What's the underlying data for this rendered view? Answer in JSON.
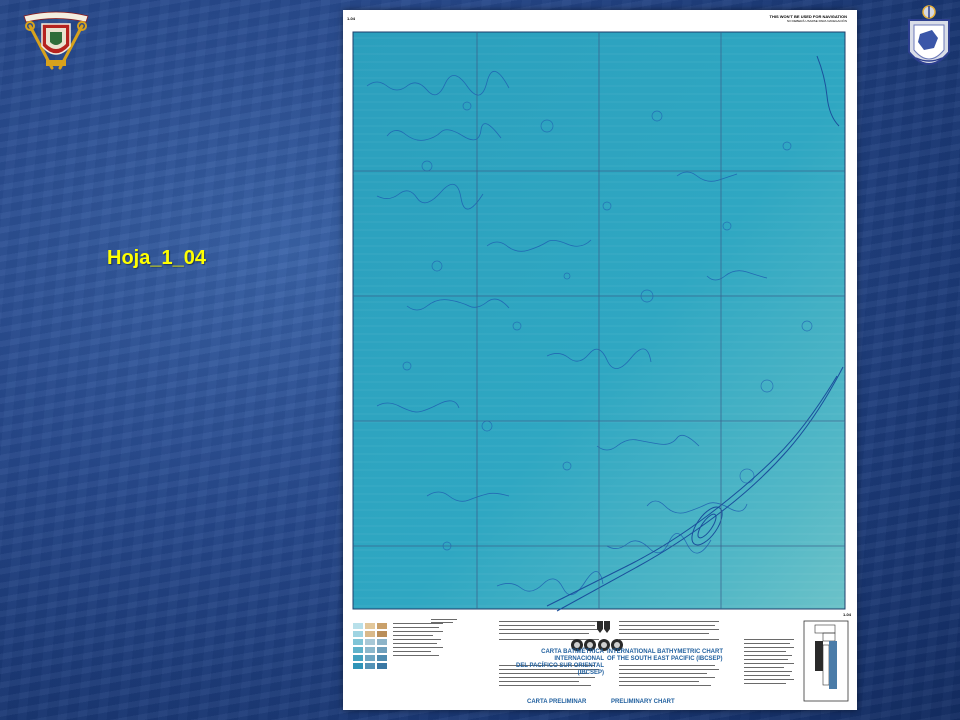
{
  "slide": {
    "title": "Hoja_1_04",
    "title_color": "#ffff00",
    "background_color": "#27498c"
  },
  "chart_sheet": {
    "sheet_id": "1-04",
    "warning": "THIS WON'T BE USED FOR NAVIGATION",
    "warning_sub": "NO DEBERÁ USARSE PARA NAVEGACIÓN",
    "title_es_line1": "CARTA BATIMÉTRICA INTERNACIONAL",
    "title_es_line2": "DEL PACÍFICO SUR ORIENTAL (IBCSEP)",
    "title_en_line1": "INTERNATIONAL BATHYMETRIC CHART",
    "title_en_line2": "OF THE SOUTH EAST PACIFIC (IBCSEP)",
    "edition_es": "CARTA PRELIMINAR",
    "edition_en": "PRELIMINARY CHART",
    "sea_color": "#2fa4bf",
    "contour_color": "#1f5fb0"
  },
  "icons": {
    "left": "navy-coat-of-arms-icon",
    "right": "hydrographic-shield-icon"
  }
}
